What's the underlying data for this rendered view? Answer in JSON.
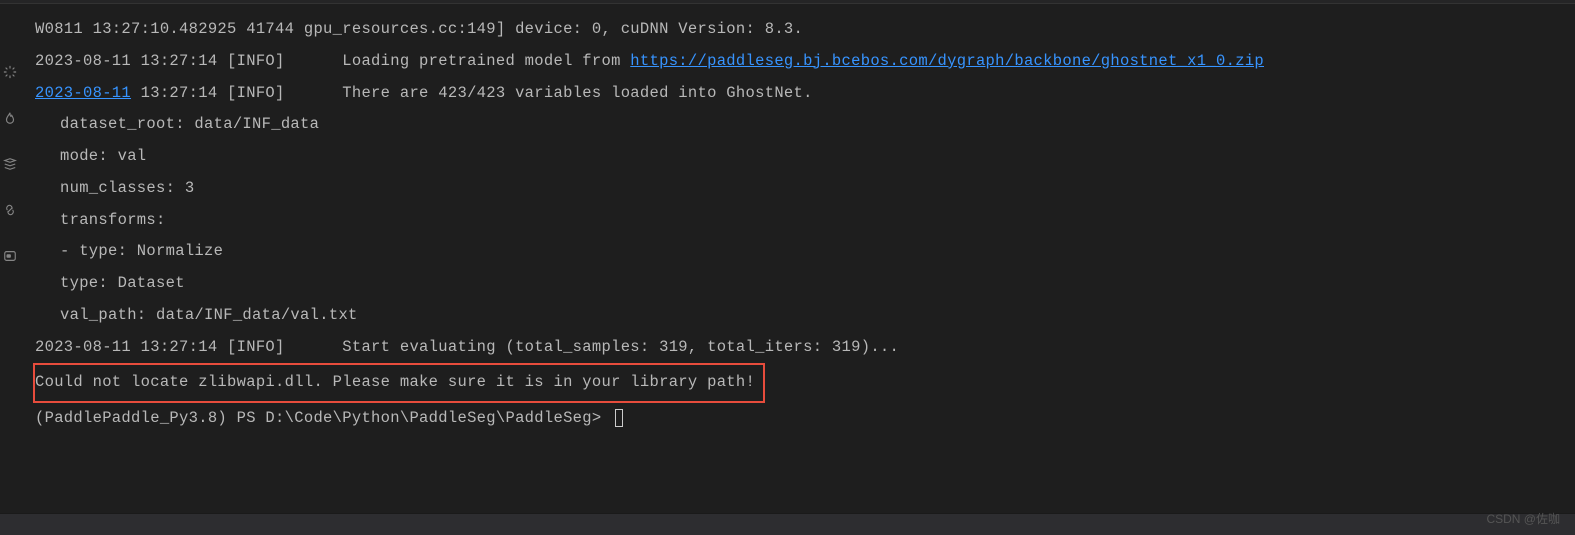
{
  "terminal": {
    "line1": "W0811 13:27:10.482925 41744 gpu_resources.cc:149] device: 0, cuDNN Version: 8.3.",
    "line2_pre": "2023-08-11 13:27:14 [INFO]\tLoading pretrained model from ",
    "line2_link": "https://paddleseg.bj.bcebos.com/dygraph/backbone/ghostnet_x1_0.zip",
    "line3_date": "2023-08-11",
    "line3_rest": " 13:27:14 [INFO]\tThere are 423/423 variables loaded into GhostNet.",
    "line4": "dataset_root: data/INF_data",
    "line5": "mode: val",
    "line6": "num_classes: 3",
    "line7": "transforms:",
    "line8": "- type: Normalize",
    "line9": "type: Dataset",
    "line10": "val_path: data/INF_data/val.txt",
    "line11": "2023-08-11 13:27:14 [INFO]\tStart evaluating (total_samples: 319, total_iters: 319)...",
    "error_line": "Could not locate zlibwapi.dll. Please make sure it is in your library path!",
    "prompt": "(PaddlePaddle_Py3.8) PS D:\\Code\\Python\\PaddleSeg\\PaddleSeg> "
  },
  "watermark": "CSDN @佐咖"
}
